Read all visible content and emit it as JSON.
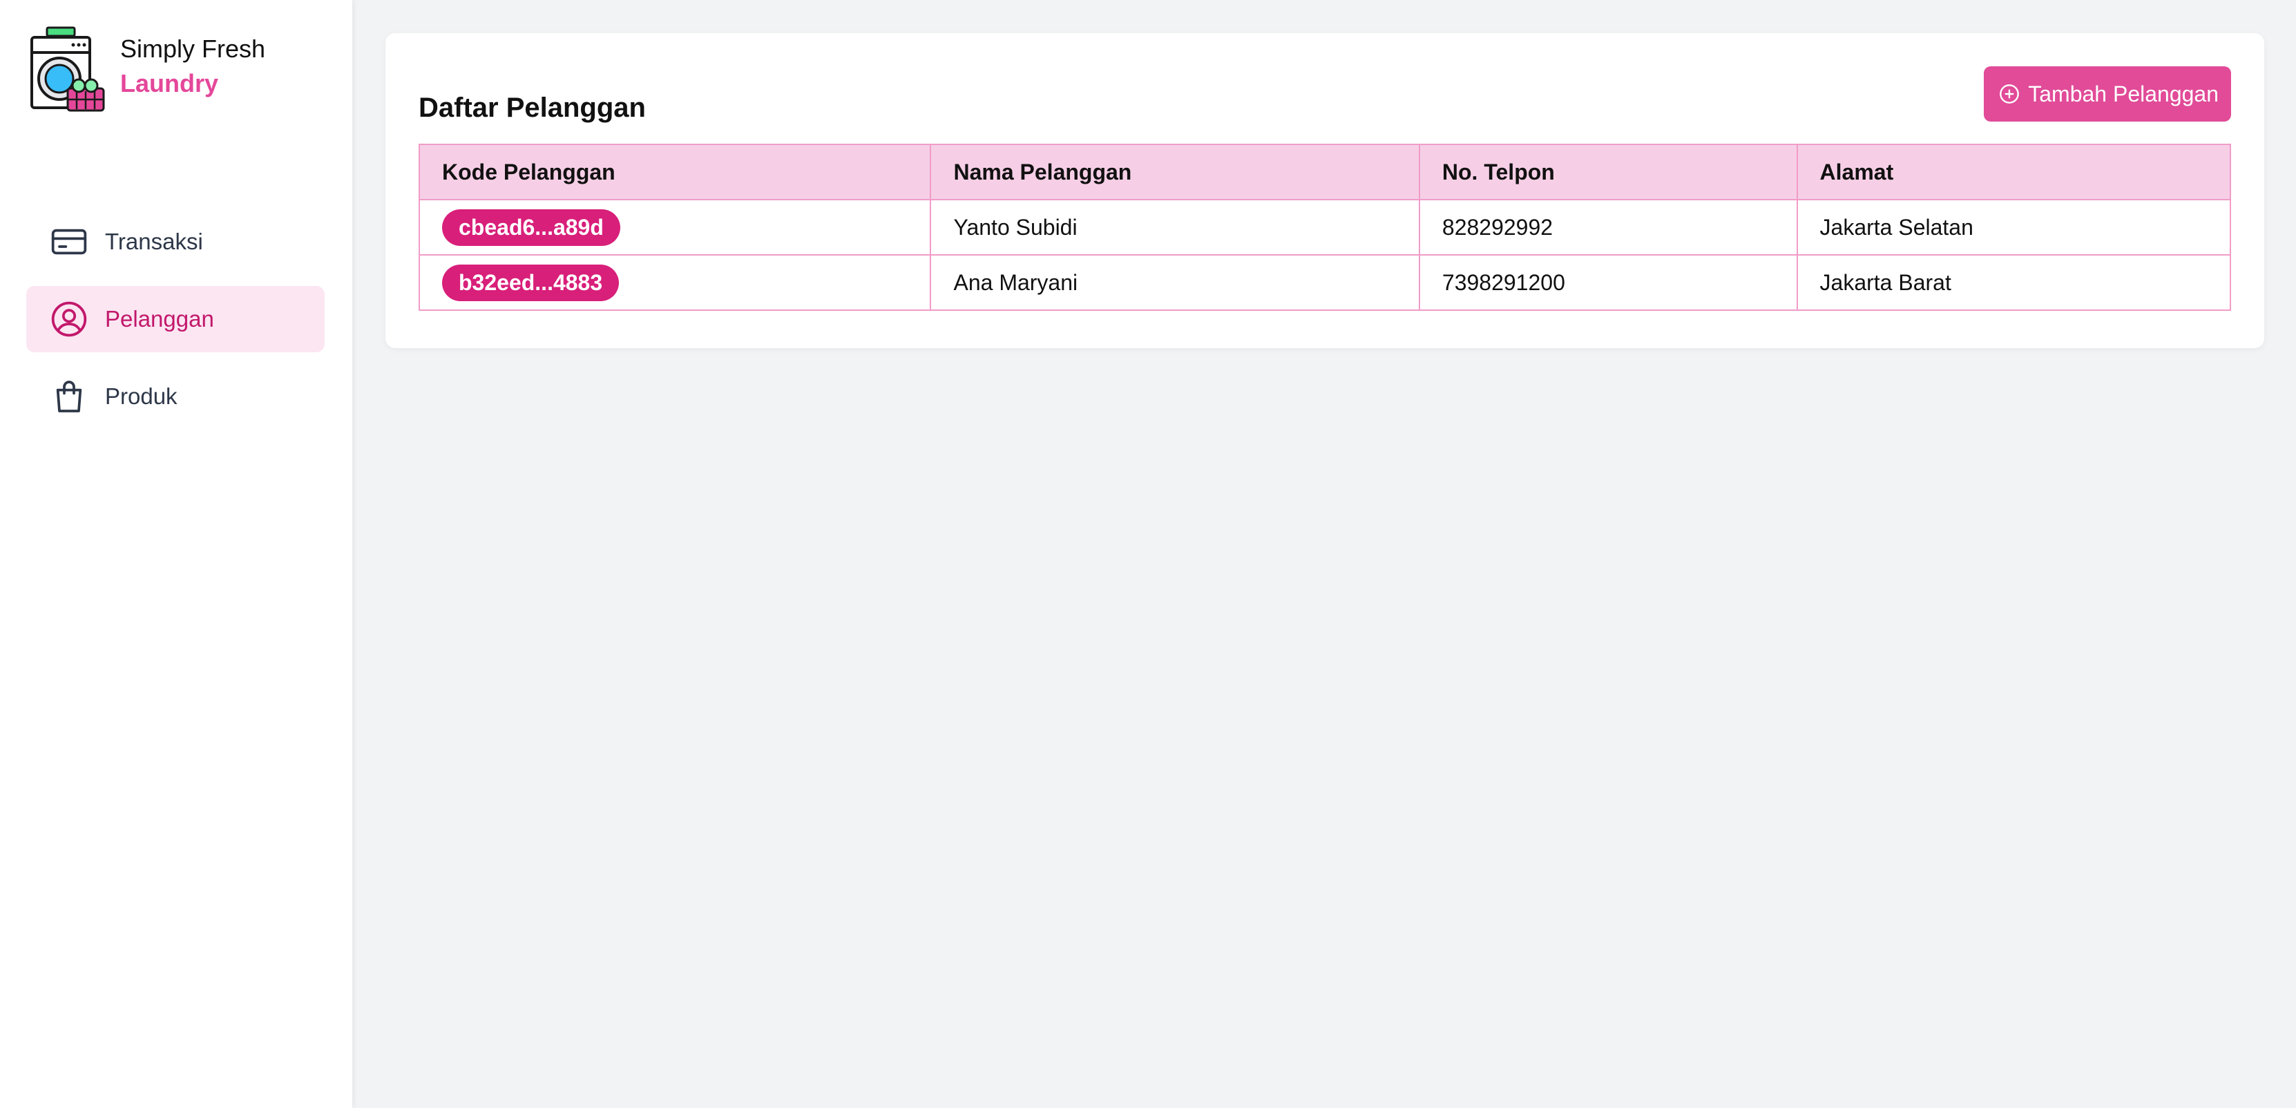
{
  "brand": {
    "name_line1": "Simply Fresh",
    "name_line2": "Laundry",
    "accent_color": "#e4479a"
  },
  "sidebar": {
    "items": [
      {
        "label": "Transaksi",
        "icon": "credit-card-icon",
        "active": false
      },
      {
        "label": "Pelanggan",
        "icon": "user-circle-icon",
        "active": true
      },
      {
        "label": "Produk",
        "icon": "shopping-bag-icon",
        "active": false
      }
    ]
  },
  "main": {
    "title": "Daftar Pelanggan",
    "add_button_label": "Tambah Pelanggan",
    "add_button_icon": "plus-circle-icon",
    "table": {
      "columns": [
        "Kode Pelanggan",
        "Nama Pelanggan",
        "No. Telpon",
        "Alamat"
      ],
      "rows": [
        {
          "code": "cbead6...a89d",
          "name": "Yanto Subidi",
          "phone": "828292992",
          "address": "Jakarta Selatan"
        },
        {
          "code": "b32eed...4883",
          "name": "Ana Maryani",
          "phone": "7398291200",
          "address": "Jakarta Barat"
        }
      ]
    }
  }
}
